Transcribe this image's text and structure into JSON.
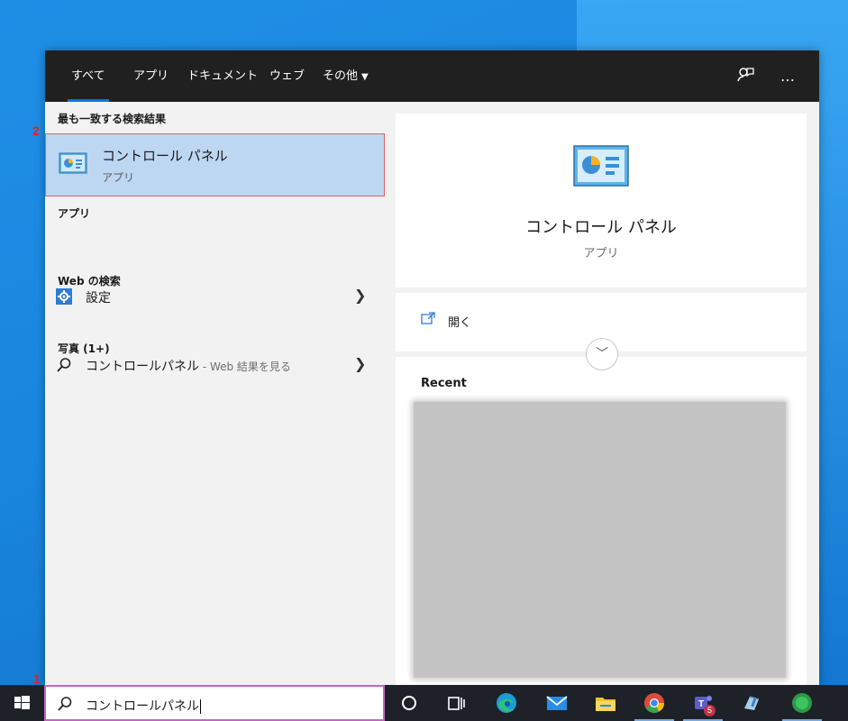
{
  "tabs": [
    {
      "label": "すべて",
      "active": true
    },
    {
      "label": "アプリ"
    },
    {
      "label": "ドキュメント"
    },
    {
      "label": "ウェブ"
    },
    {
      "label": "その他"
    }
  ],
  "tabbar_icons": [
    "feedback-icon",
    "more-icon"
  ],
  "tabbar_more_label": "…",
  "left": {
    "best_match_heading": "最も一致する検索結果",
    "best_match": {
      "title": "コントロール パネル",
      "subtitle": "アプリ",
      "icon": "control-panel-icon"
    },
    "apps_heading": "アプリ",
    "apps": [
      {
        "label": "設定",
        "icon": "settings-gear-icon"
      }
    ],
    "web_heading": "Web の検索",
    "web": {
      "label": "コントロールパネル",
      "suffix": " - Web 結果を見る",
      "icon": "search-icon"
    },
    "photos_heading": "写真 (1+)"
  },
  "right": {
    "title": "コントロール パネル",
    "subtitle": "アプリ",
    "open_label": "開く",
    "recent_heading": "Recent"
  },
  "markers": {
    "search": "1",
    "result": "2"
  },
  "search": {
    "value": "コントロールパネル",
    "icon": "search-icon"
  },
  "taskbar": {
    "items": [
      "cortana-icon",
      "task-view-icon",
      "edge-icon",
      "mail-icon",
      "file-explorer-icon",
      "chrome-icon",
      "teams-icon",
      "paint-icon",
      "app-icon"
    ],
    "teams_badge": "5"
  },
  "colors": {
    "accent": "#0a78d7",
    "selection": "#bdd6f2",
    "marker": "#dd2222",
    "taskbar": "#1e2128"
  }
}
